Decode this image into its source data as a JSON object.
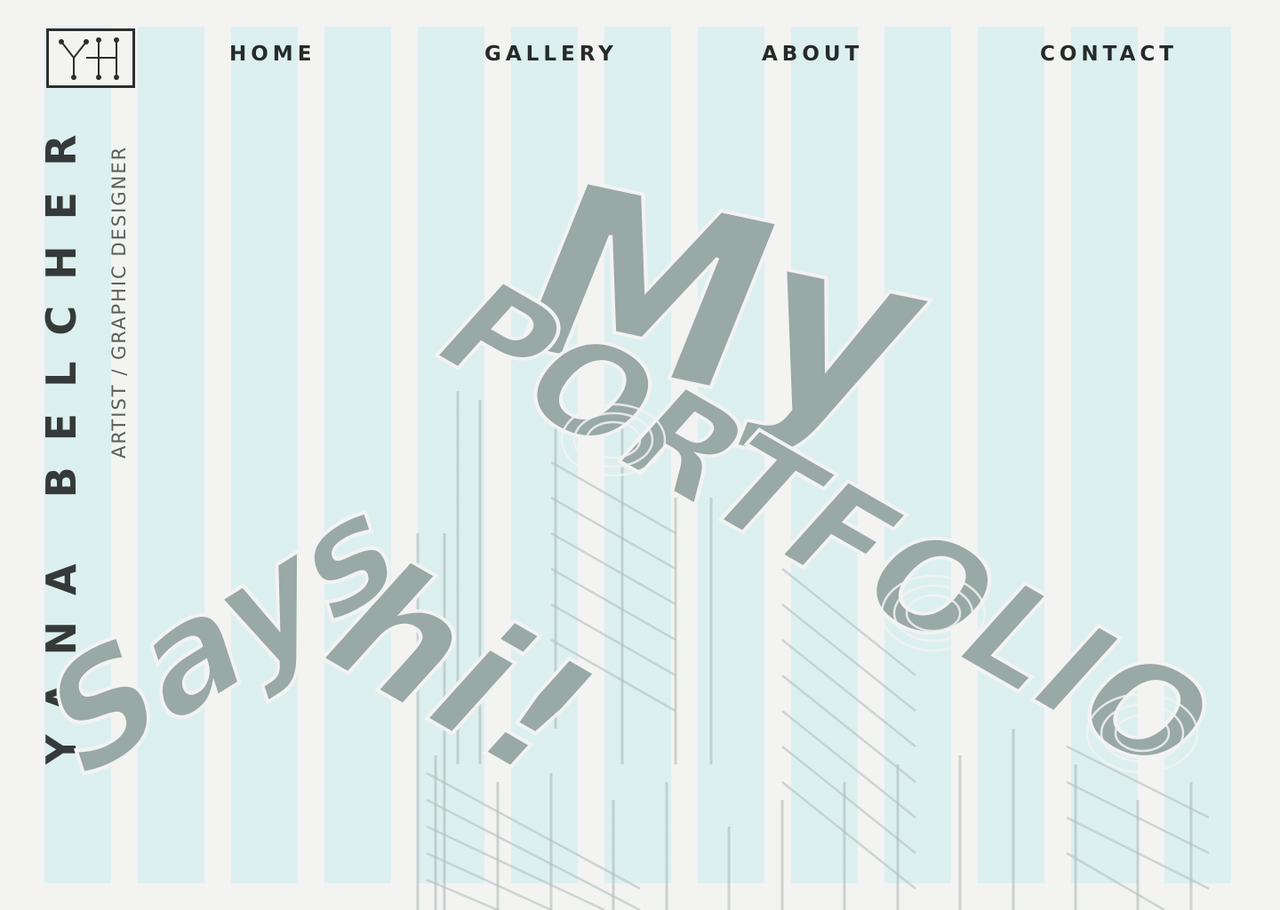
{
  "brand": {
    "logo_text": "YH",
    "name": "YANA BELCHER",
    "tagline": "ARTIST / GRAPHIC DESIGNER"
  },
  "nav": [
    {
      "label": "HOME"
    },
    {
      "label": "GALLERY"
    },
    {
      "label": "ABOUT"
    },
    {
      "label": "CONTACT"
    }
  ],
  "hero": {
    "line_my": "My",
    "line_portfolio": "PORTFOLIO",
    "line_says": "Says",
    "line_hi": "hi!"
  },
  "colors": {
    "background": "#f3f3f2",
    "stripe": "#d9efef",
    "hero_text": "#98a9a6",
    "text_dark": "#2f3433"
  }
}
